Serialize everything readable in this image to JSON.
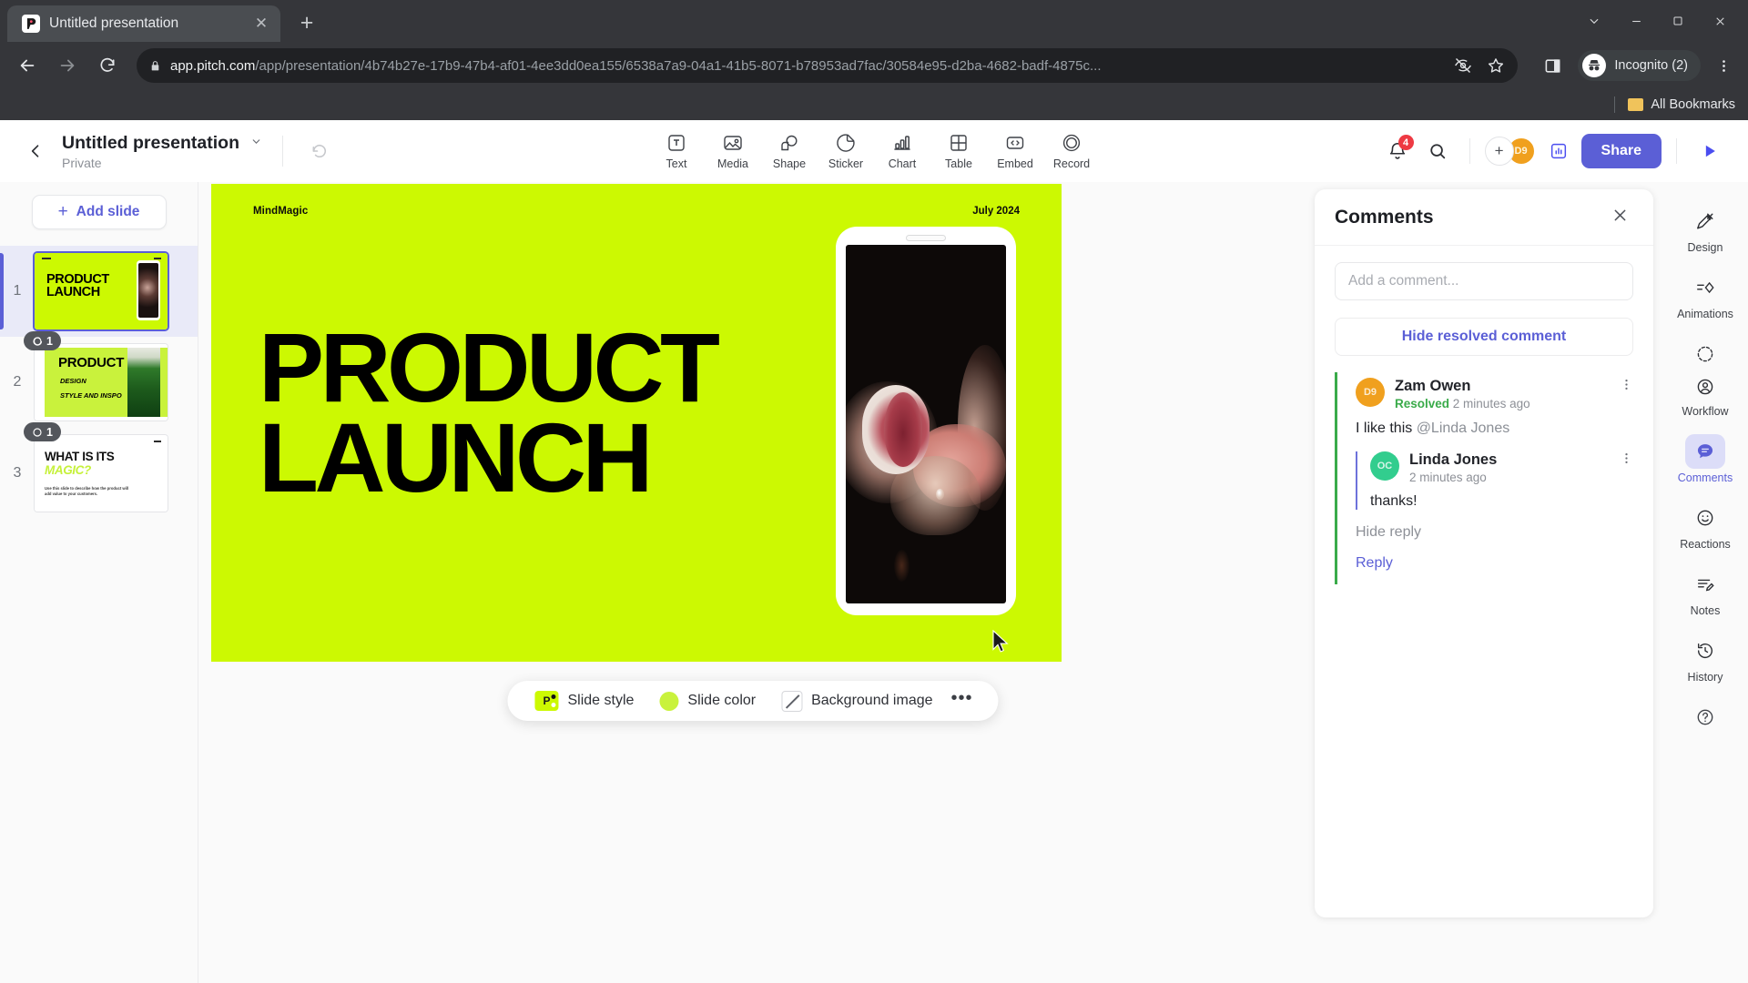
{
  "browser": {
    "tab": {
      "title": "Untitled presentation",
      "favicon_letter": "P",
      "close_icon": "close-icon"
    },
    "new_tab_glyph": "+",
    "window_controls": {
      "minimize": "–",
      "maximize": "□",
      "close": "✕",
      "restore_caret": "⌄"
    },
    "url_secure": "app.pitch.com",
    "url_path": "/app/presentation/4b74b27e-17b9-47b4-af01-4ee3dd0ea155/6538a7a9-04a1-41b5-8071-b78953ad7fac/30584e95-d2ba-4682-badf-4875c...",
    "profile_label": "Incognito (2)",
    "bookmarks_label": "All Bookmarks"
  },
  "app_header": {
    "doc_title": "Untitled presentation",
    "doc_privacy": "Private",
    "tools": [
      {
        "label": "Text",
        "icon": "text-icon"
      },
      {
        "label": "Media",
        "icon": "media-icon"
      },
      {
        "label": "Shape",
        "icon": "shape-icon"
      },
      {
        "label": "Sticker",
        "icon": "sticker-icon"
      },
      {
        "label": "Chart",
        "icon": "chart-icon"
      },
      {
        "label": "Table",
        "icon": "table-icon"
      },
      {
        "label": "Embed",
        "icon": "embed-icon"
      },
      {
        "label": "Record",
        "icon": "record-icon"
      }
    ],
    "notification_count": "4",
    "add_person_glyph": "+",
    "collaborator_initials": "D9",
    "share_label": "Share",
    "accent_color": "#5b5fd6"
  },
  "slides_rail": {
    "add_slide_label": "Add slide",
    "add_slide_glyph": "+",
    "slides": [
      {
        "number": "1",
        "title_line1": "PRODUCT",
        "title_line2": "LAUNCH",
        "comment_count": "",
        "selected": true
      },
      {
        "number": "2",
        "title": "PRODUCT",
        "sub1": "DESIGN",
        "sub2": "STYLE AND INSPO",
        "comment_count": "1",
        "selected": false
      },
      {
        "number": "3",
        "title_line1": "WHAT IS ITS",
        "title_line2": "MAGIC?",
        "body": "Use this slide to describe how the product will add value to your customers.",
        "comment_count": "1",
        "selected": false
      }
    ]
  },
  "slide_canvas": {
    "brand": "MindMagic",
    "date": "July 2024",
    "title": "PRODUCT\nLAUNCH",
    "background_color": "#ccf902",
    "phone_image_alt": "lip-balm-product-photo"
  },
  "style_bar": {
    "slide_style_label": "Slide style",
    "slide_style_badge": "P",
    "slide_color_label": "Slide color",
    "slide_color_value": "#c9f23c",
    "background_image_label": "Background image",
    "more_glyph": "•••"
  },
  "comments": {
    "panel_title": "Comments",
    "close_icon": "close-icon",
    "input_placeholder": "Add a comment...",
    "hide_resolved_label": "Hide resolved comment",
    "threads": [
      {
        "author": "Zam Owen",
        "avatar_initials": "D9",
        "avatar_color": "#f0a01e",
        "status": "Resolved",
        "timestamp": "2 minutes ago",
        "text_prefix": "I like this ",
        "mention": "@Linda Jones",
        "replies": [
          {
            "author": "Linda Jones",
            "avatar_initials": "OC",
            "avatar_color": "#32cd8e",
            "timestamp": "2 minutes ago",
            "text": "thanks!"
          }
        ],
        "hide_reply_label": "Hide reply",
        "reply_label": "Reply"
      }
    ]
  },
  "right_rail": {
    "items": [
      {
        "label": "Design",
        "icon": "design-icon",
        "active": false
      },
      {
        "label": "Animations",
        "icon": "animations-icon",
        "active": false
      },
      {
        "label": "Workflow",
        "icon": "workflow-icon",
        "active": false
      },
      {
        "label": "Comments",
        "icon": "comments-icon",
        "active": true
      },
      {
        "label": "Reactions",
        "icon": "reactions-icon",
        "active": false
      },
      {
        "label": "Notes",
        "icon": "notes-icon",
        "active": false
      },
      {
        "label": "History",
        "icon": "history-icon",
        "active": false
      }
    ],
    "help_icon": "help-icon"
  }
}
